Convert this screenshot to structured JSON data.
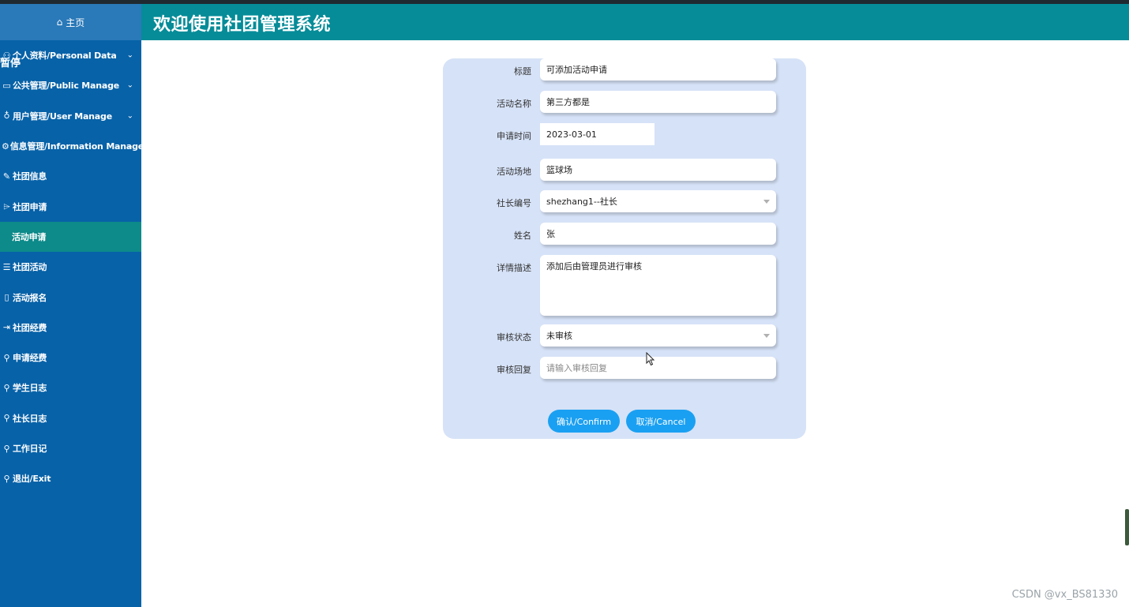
{
  "header": {
    "title": "欢迎使用社团管理系统"
  },
  "overlay": {
    "pause_text": "暂停"
  },
  "sidebar": {
    "home": {
      "icon": "home-icon",
      "label": "主页"
    },
    "items": [
      {
        "icon": "user-icon",
        "label": "个人资料/Personal Data",
        "chevron": true
      },
      {
        "icon": "monitor-icon",
        "label": "公共管理/Public Manage",
        "chevron": true
      },
      {
        "icon": "users-icon",
        "label": "用户管理/User Manage",
        "chevron": true
      },
      {
        "icon": "gear-icon",
        "label": "信息管理/Information Manage",
        "chevron": true
      },
      {
        "icon": "edit-icon",
        "label": "社团信息",
        "chevron": false
      },
      {
        "icon": "tag-icon",
        "label": "社团申请",
        "chevron": false
      },
      {
        "icon": "",
        "label": "活动申请",
        "chevron": false,
        "active": true
      },
      {
        "icon": "list-icon",
        "label": "社团活动",
        "chevron": false
      },
      {
        "icon": "book-icon",
        "label": "活动报名",
        "chevron": false
      },
      {
        "icon": "export-icon",
        "label": "社团经费",
        "chevron": false
      },
      {
        "icon": "user-list-icon",
        "label": "申请经费",
        "chevron": false
      },
      {
        "icon": "user-list-icon",
        "label": "学生日志",
        "chevron": false
      },
      {
        "icon": "user-list-icon",
        "label": "社长日志",
        "chevron": false
      },
      {
        "icon": "user-list-icon",
        "label": "工作日记",
        "chevron": false
      },
      {
        "icon": "user-list-icon",
        "label": "退出/Exit",
        "chevron": false
      }
    ]
  },
  "form": {
    "fields": {
      "title": {
        "label": "标题",
        "value": "可添加活动申请"
      },
      "activity_name": {
        "label": "活动名称",
        "value": "第三方都是"
      },
      "apply_time": {
        "label": "申请时间",
        "value": "2023-03-01"
      },
      "venue": {
        "label": "活动场地",
        "value": "篮球场"
      },
      "leader_id": {
        "label": "社长编号",
        "value": "shezhang1--社长"
      },
      "name": {
        "label": "姓名",
        "value": "张"
      },
      "description": {
        "label": "详情描述",
        "value": "添加后由管理员进行审核"
      },
      "review_status": {
        "label": "审核状态",
        "value": "未审核"
      },
      "review_reply": {
        "label": "审核回复",
        "placeholder": "请输入审核回复"
      }
    },
    "confirm_label": "确认/Confirm",
    "cancel_label": "取消/Cancel"
  },
  "watermark": "CSDN @vx_BS81330",
  "colors": {
    "sidebar": "#0762a8",
    "header": "#058c98",
    "active_item": "#0d8a8a",
    "card": "#d6e2f7",
    "button": "#1aa0f2"
  }
}
